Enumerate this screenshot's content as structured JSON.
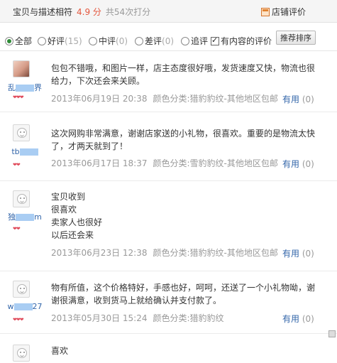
{
  "header": {
    "desc_label": "宝贝与描述相符",
    "score": "4.9 分",
    "total": "共54次打分",
    "shop_link": "店铺评价"
  },
  "filters": {
    "all": "全部",
    "good": "好评",
    "good_count": "(15)",
    "neutral": "中评",
    "neutral_count": "(0)",
    "bad": "差评",
    "bad_count": "(0)",
    "followup": "追评",
    "has_content": "有内容的评价",
    "sort_button": "推荐排序"
  },
  "reviews": [
    {
      "user_prefix": "乱",
      "user_suffix": "界",
      "hearts": "❤❤❤",
      "lines": [
        "包包不错哦，和图片一样，店主态度很好哦，发货速度又快，物流也很",
        "给力，下次还会来关顾。"
      ],
      "date": "2013年06月19日 20:38",
      "sku": "颜色分类:猎豹豹纹-其他地区包邮",
      "useful": "有用",
      "useful_count": "(0)"
    },
    {
      "user_prefix": "tb",
      "user_suffix": "",
      "hearts": "❤❤",
      "lines": [
        "这次网购非常满意，谢谢店家送的小礼物，很喜欢。重要的是物流太快",
        "了，才两天就到了！"
      ],
      "date": "2013年06月17日 18:37",
      "sku": "颜色分类:雪豹豹纹-其他地区包邮",
      "useful": "有用",
      "useful_count": "(0)"
    },
    {
      "user_prefix": "独",
      "user_suffix": "m",
      "hearts": "❤❤",
      "lines": [
        "宝贝收到",
        "很喜欢",
        "卖家人也很好",
        "以后还会来"
      ],
      "date": "2013年06月23日 12:38",
      "sku": "颜色分类:猎豹豹纹-其他地区包邮",
      "useful": "有用",
      "useful_count": "(0)"
    },
    {
      "user_prefix": "w",
      "user_suffix": "27",
      "hearts": "❤❤❤",
      "lines": [
        "物有所值，这个价格特好，手感也好，呵呵，还送了一个小礼物呦，谢",
        "谢很满意，收到货马上就给确认并支付款了。"
      ],
      "date": "2013年05月30日 15:24",
      "sku": "颜色分类:猎豹豹纹",
      "useful": "有用",
      "useful_count": "(0)"
    },
    {
      "user_prefix": "",
      "user_suffix": "",
      "hearts": "",
      "lines": [
        "喜欢",
        "…"
      ],
      "date": "",
      "sku": "",
      "useful": "",
      "useful_count": ""
    }
  ]
}
